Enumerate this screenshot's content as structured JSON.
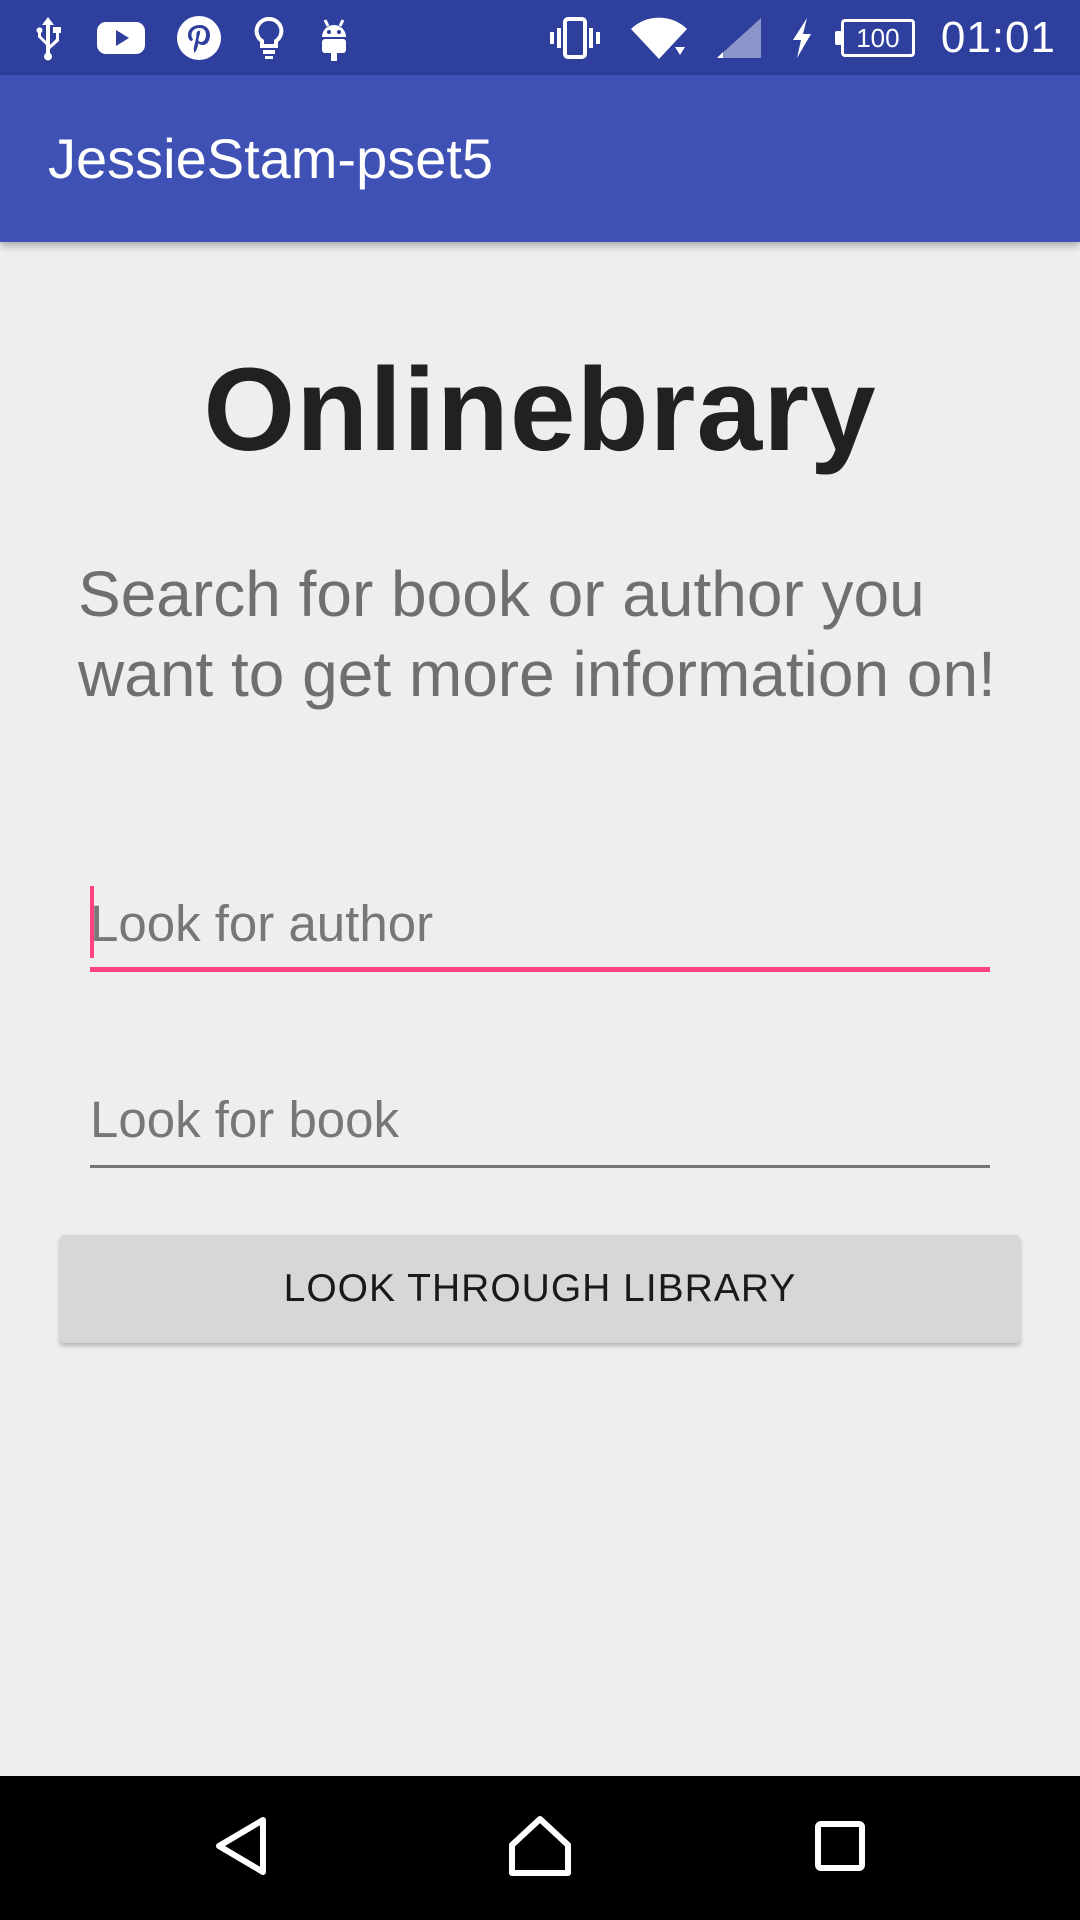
{
  "status_bar": {
    "time": "01:01",
    "battery_level": "100",
    "left_icons": [
      "usb-icon",
      "youtube-icon",
      "pinterest-icon",
      "lightbulb-icon",
      "android-icon"
    ],
    "right_icons": [
      "vibrate-icon",
      "wifi-icon",
      "signal-icon",
      "charging-icon",
      "battery-icon"
    ]
  },
  "app_bar": {
    "title": "JessieStam-pset5"
  },
  "main": {
    "headline": "Onlinebrary",
    "subtitle": "Search for book or author you want to get more information on!",
    "author_field": {
      "placeholder": "Look for author",
      "value": ""
    },
    "book_field": {
      "placeholder": "Look for book",
      "value": ""
    },
    "search_button_label": "LOOK THROUGH LIBRARY"
  },
  "nav_bar": {
    "buttons": [
      "back-icon",
      "home-icon",
      "recents-icon"
    ]
  },
  "colors": {
    "status_bar": "#2f3f9e",
    "app_bar": "#3f51b5",
    "accent": "#ff4081",
    "background": "#eeeeee",
    "button": "#d6d7d7"
  }
}
